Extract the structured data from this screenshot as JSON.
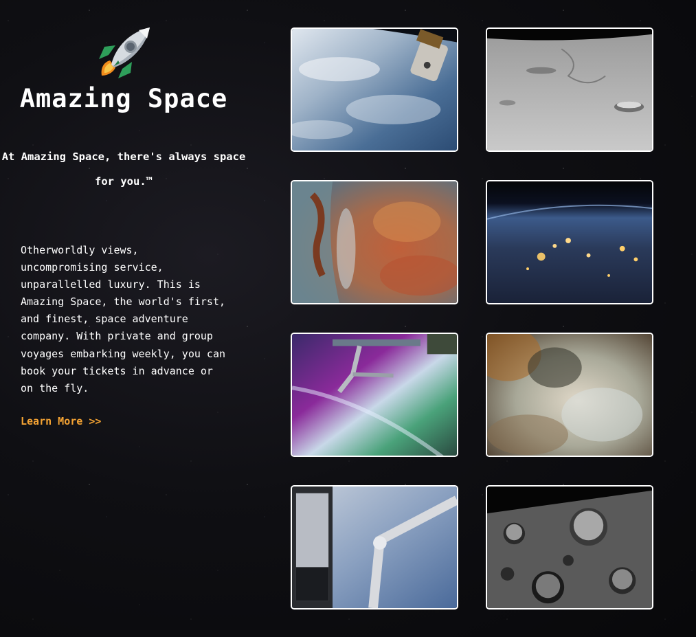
{
  "site": {
    "logo_icon": "rocket-icon",
    "title": "Amazing Space",
    "tagline": "At Amazing Space, there's always space for you.™"
  },
  "intro": {
    "description": "Otherworldly views, uncompromising service, unparallelled luxury. This is Amazing Space, the world's first, and finest, space adventure company. With private and group voyages embarking weekly, you can book your tickets in advance or on the fly.",
    "link_label": "Learn More >>"
  },
  "colors": {
    "accent": "#f3a233",
    "background": "#0f0f13",
    "frame": "#ffffff"
  },
  "gallery": [
    {
      "subject": "earth-with-space-station-module"
    },
    {
      "subject": "lunar-surface-craters"
    },
    {
      "subject": "orange-nebula-pillars"
    },
    {
      "subject": "earth-at-night-city-lights"
    },
    {
      "subject": "aurora-with-robotic-arm"
    },
    {
      "subject": "colorful-nebula-clouds"
    },
    {
      "subject": "hubble-telescope-over-earth"
    },
    {
      "subject": "cratered-moon-landscape"
    }
  ]
}
